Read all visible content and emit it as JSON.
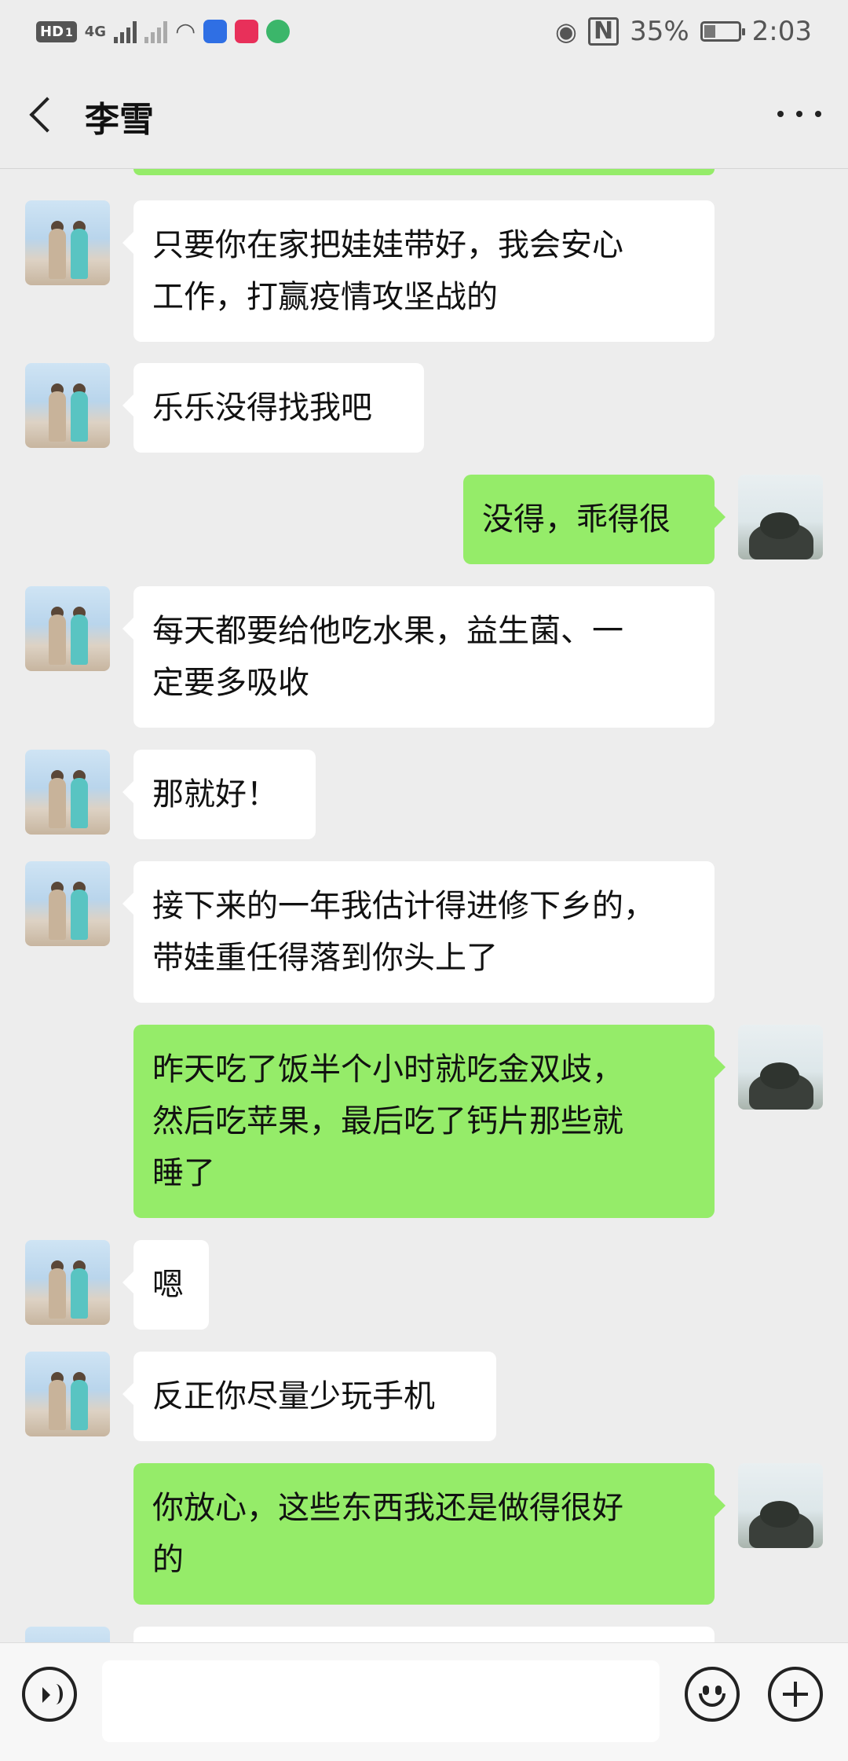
{
  "status_bar": {
    "hd_label": "HD",
    "sim_label": "1",
    "net_label": "4G",
    "battery_percent": "35%",
    "battery_level": 0.35,
    "time": "2:03",
    "icons": [
      "hd-icon",
      "signal-icon",
      "signal-icon",
      "wifi-icon",
      "baidu-icon",
      "video-app-icon",
      "browser-icon",
      "eye-icon",
      "nfc-icon",
      "battery-icon"
    ]
  },
  "header": {
    "title": "李雪",
    "back_icon": "chevron-left-icon",
    "more_icon": "more-icon"
  },
  "messages": [
    {
      "side": "left",
      "text": "只要你在家把娃娃带好，我会安心\n工作，打赢疫情攻坚战的"
    },
    {
      "side": "left",
      "text": "乐乐没得找我吧"
    },
    {
      "side": "right",
      "text": "没得，乖得很"
    },
    {
      "side": "left",
      "text": "每天都要给他吃水果，益生菌、一\n定要多吸收"
    },
    {
      "side": "left",
      "text": "那就好！"
    },
    {
      "side": "left",
      "text": "接下来的一年我估计得进修下乡的，\n带娃重任得落到你头上了"
    },
    {
      "side": "right",
      "text": "昨天吃了饭半个小时就吃金双歧，\n然后吃苹果，最后吃了钙片那些就\n睡了"
    },
    {
      "side": "left",
      "text": "嗯"
    },
    {
      "side": "left",
      "text": "反正你尽量少玩手机"
    },
    {
      "side": "right",
      "text": "你放心，这些东西我还是做得很好\n的"
    }
  ],
  "input_bar": {
    "voice_icon": "voice-icon",
    "emoji_icon": "emoji-icon",
    "plus_icon": "plus-icon",
    "text_value": ""
  },
  "colors": {
    "background": "#ededed",
    "bubble_in": "#ffffff",
    "bubble_out": "#95ec69"
  }
}
